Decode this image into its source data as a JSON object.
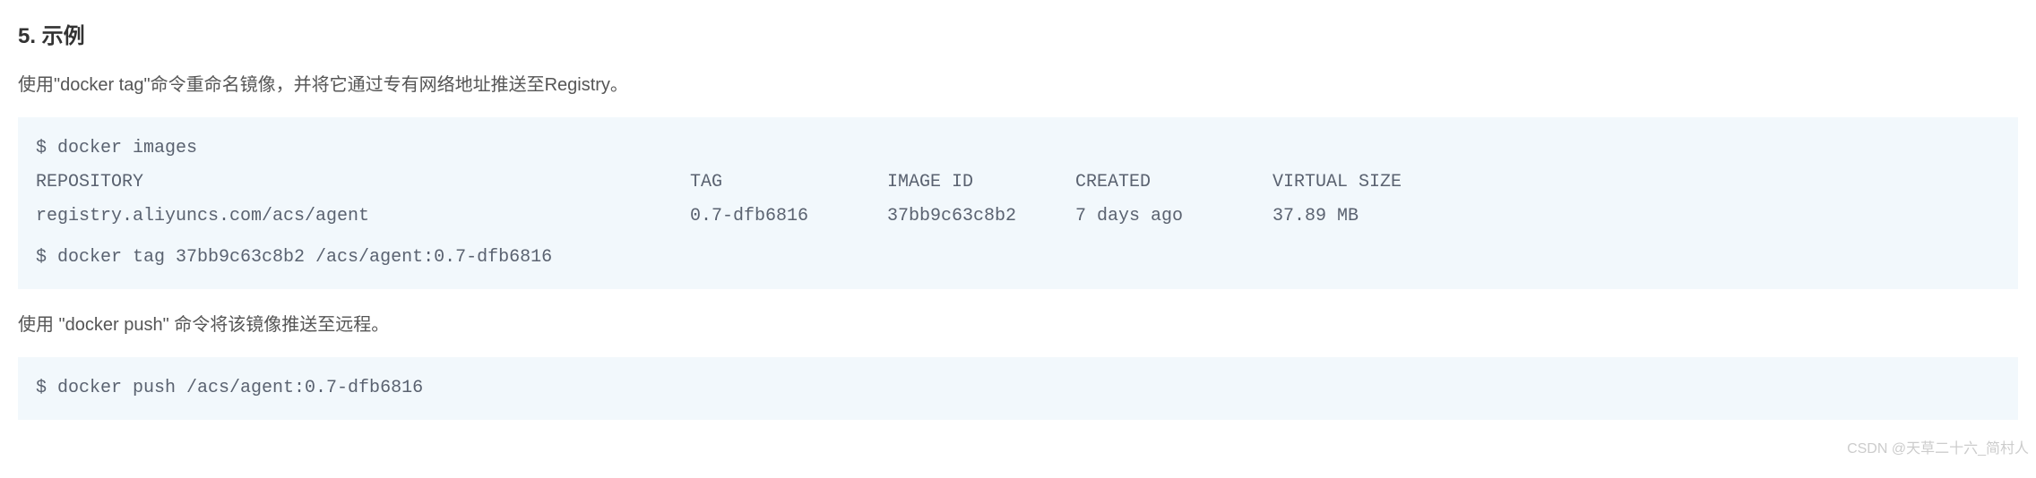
{
  "heading": "5. 示例",
  "paragraph1": "使用\"docker tag\"命令重命名镜像，并将它通过专有网络地址推送至Registry。",
  "codeblock1": {
    "line1": "$ docker images",
    "header": {
      "repository": "REPOSITORY",
      "tag": "TAG",
      "image_id": "IMAGE ID",
      "created": "CREATED",
      "virtual_size": "VIRTUAL SIZE"
    },
    "row": {
      "repository": "registry.aliyuncs.com/acs/agent",
      "tag": "0.7-dfb6816",
      "image_id": "37bb9c63c8b2",
      "created": "7 days ago",
      "virtual_size": "37.89 MB"
    },
    "line4": "$ docker tag 37bb9c63c8b2 /acs/agent:0.7-dfb6816"
  },
  "paragraph2": "使用 \"docker push\" 命令将该镜像推送至远程。",
  "codeblock2": {
    "line1": "$ docker push /acs/agent:0.7-dfb6816"
  },
  "watermark": "CSDN @天草二十六_简村人"
}
